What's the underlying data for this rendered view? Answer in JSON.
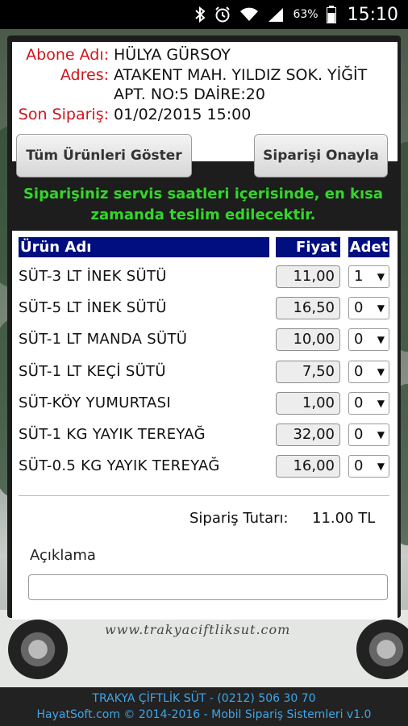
{
  "status_bar": {
    "battery_percent": "63%",
    "time": "15:10",
    "icons": [
      "bluetooth-icon",
      "alarm-icon",
      "wifi-icon",
      "signal-icon",
      "battery-icon"
    ]
  },
  "customer": {
    "name_label": "Abone Adı:",
    "name_value": "HÜLYA GÜRSOY",
    "address_label": "Adres:",
    "address_line1": "ATAKENT MAH. YILDIZ SOK. YİĞİT",
    "address_line2": "APT. NO:5 DAİRE:20",
    "last_order_label": "Son Sipariş:",
    "last_order_value": "01/02/2015  15:00"
  },
  "buttons": {
    "show_all": "Tüm Ürünleri Göster",
    "confirm": "Siparişi Onayla"
  },
  "notice": "Siparişiniz servis saatleri içerisinde, en kısa zamanda teslim edilecektir.",
  "table": {
    "col_product": "Ürün Adı",
    "col_price": "Fiyat",
    "col_qty": "Adet",
    "rows": [
      {
        "name": "SÜT-3 LT İNEK SÜTÜ",
        "price": "11,00",
        "qty": "1"
      },
      {
        "name": "SÜT-5 LT İNEK SÜTÜ",
        "price": "16,50",
        "qty": "0"
      },
      {
        "name": "SÜT-1 LT MANDA SÜTÜ",
        "price": "10,00",
        "qty": "0"
      },
      {
        "name": "SÜT-1 LT KEÇİ SÜTÜ",
        "price": "7,50",
        "qty": "0"
      },
      {
        "name": "SÜT-KÖY YUMURTASI",
        "price": "1,00",
        "qty": "0"
      },
      {
        "name": "SÜT-1 KG YAYIK TEREYAĞ",
        "price": "32,00",
        "qty": "0"
      },
      {
        "name": "SÜT-0.5 KG YAYIK TEREYAĞ",
        "price": "16,00",
        "qty": "0"
      }
    ]
  },
  "total": {
    "label": "Sipariş Tutarı:",
    "value": "11.00 TL"
  },
  "description": {
    "label": "Açıklama",
    "value": ""
  },
  "background": {
    "truck_text": "www.trakyaciftliksut.com"
  },
  "footer": {
    "line1": "TRAKYA ÇİFTLİK SÜT - (0212) 506 30 70",
    "line2": "HayatSoft.com © 2014-2016 - Mobil Sipariş Sistemleri v1.0"
  },
  "colors": {
    "label_red": "#d0141c",
    "notice_green": "#34d62a",
    "header_blue": "#000e80",
    "footer_blue": "#3fa6e8"
  }
}
